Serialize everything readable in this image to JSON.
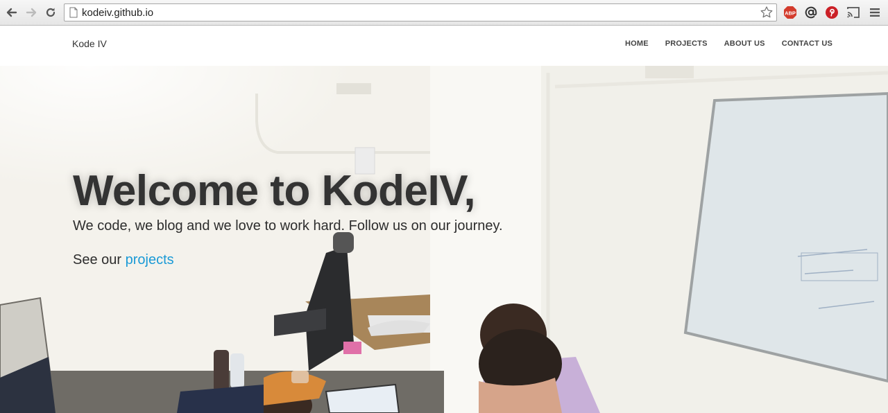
{
  "browser": {
    "url": "kodeiv.github.io",
    "extensions": [
      "adblock-icon",
      "at-sign-icon",
      "pinterest-icon",
      "cast-icon",
      "menu-icon"
    ],
    "adblock_label": "ABP"
  },
  "site": {
    "brand": "Kode IV",
    "menu": [
      {
        "label": "HOME"
      },
      {
        "label": "PROJECTS"
      },
      {
        "label": "ABOUT US"
      },
      {
        "label": "CONTACT US"
      }
    ]
  },
  "hero": {
    "title": "Welcome to KodeIV,",
    "subtitle": "We code, we blog and we love to work hard. Follow us on our journey.",
    "cta_prefix": "See our ",
    "cta_link": "projects",
    "link_color": "#1a9ad6"
  }
}
